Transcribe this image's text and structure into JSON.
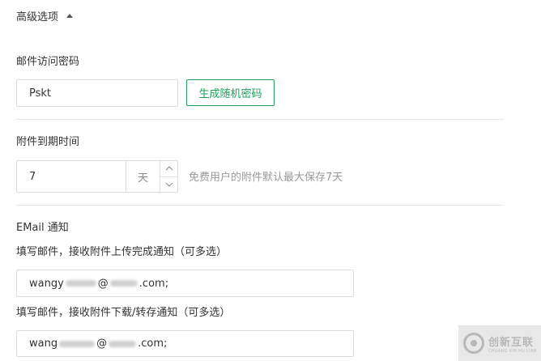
{
  "advanced": {
    "title": "高级选项"
  },
  "mail_password": {
    "label": "邮件访问密码",
    "value": "Pskt",
    "generate_label": "生成随机密码"
  },
  "attachment_expiry": {
    "label": "附件到期时间",
    "value": "7",
    "unit": "天",
    "hint": "免费用户的附件默认最大保存7天"
  },
  "email_notify": {
    "title": "EMail 通知",
    "upload": {
      "label": "填写邮件，接收附件上传完成通知（可多选）",
      "value_prefix": "wangy",
      "at": "@",
      "suffix": ".com;"
    },
    "download": {
      "label": "填写邮件，接收附件下载/转存通知（可多选）",
      "value_prefix": "wang",
      "at": "@",
      "suffix": ".com;"
    }
  },
  "watermark": {
    "cn": "创新互联",
    "en": "CHUANG XIN HU LIAN"
  }
}
